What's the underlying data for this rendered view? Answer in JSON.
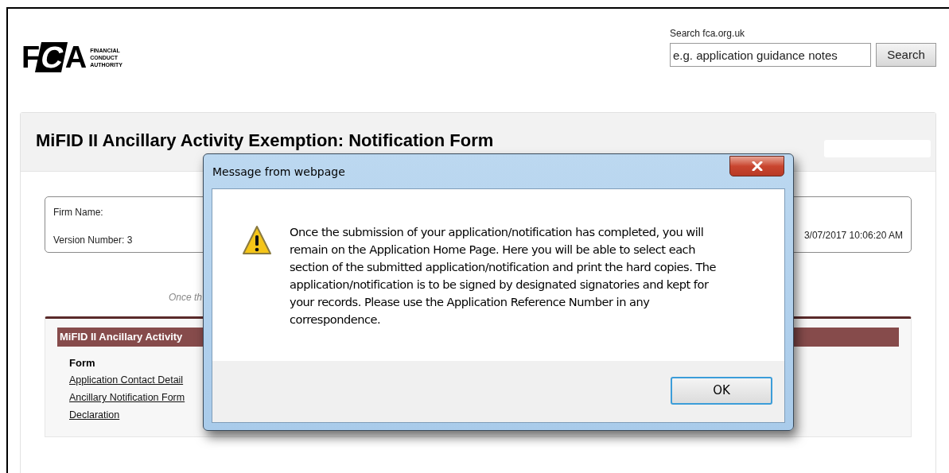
{
  "logo": {
    "letters": "FCA",
    "lines": [
      "FINANCIAL",
      "CONDUCT",
      "AUTHORITY"
    ]
  },
  "search": {
    "label": "Search fca.org.uk",
    "placeholder": "e.g. application guidance notes",
    "button": "Search"
  },
  "form": {
    "title": "MiFID II Ancillary Activity Exemption: Notification Form",
    "firm_name": "Firm Name:",
    "version": "Version Number: 3",
    "date": "3/07/2017 10:06:20 AM",
    "note": "Once th",
    "section": {
      "title": "MiFID II Ancillary Activity",
      "column_header": "Form",
      "links": [
        "Application Contact Detail",
        "Ancillary Notification Form",
        "Declaration"
      ]
    }
  },
  "dialog": {
    "title": "Message from webpage",
    "message": "Once the submission of your application/notification has completed, you will remain on the Application Home Page. Here you will be able to select each section of the submitted application/notification and print the hard copies. The application/notification is to be signed by designated signatories and kept for your records.  Please use the Application Reference Number in any correspondence.",
    "button": "OK"
  }
}
